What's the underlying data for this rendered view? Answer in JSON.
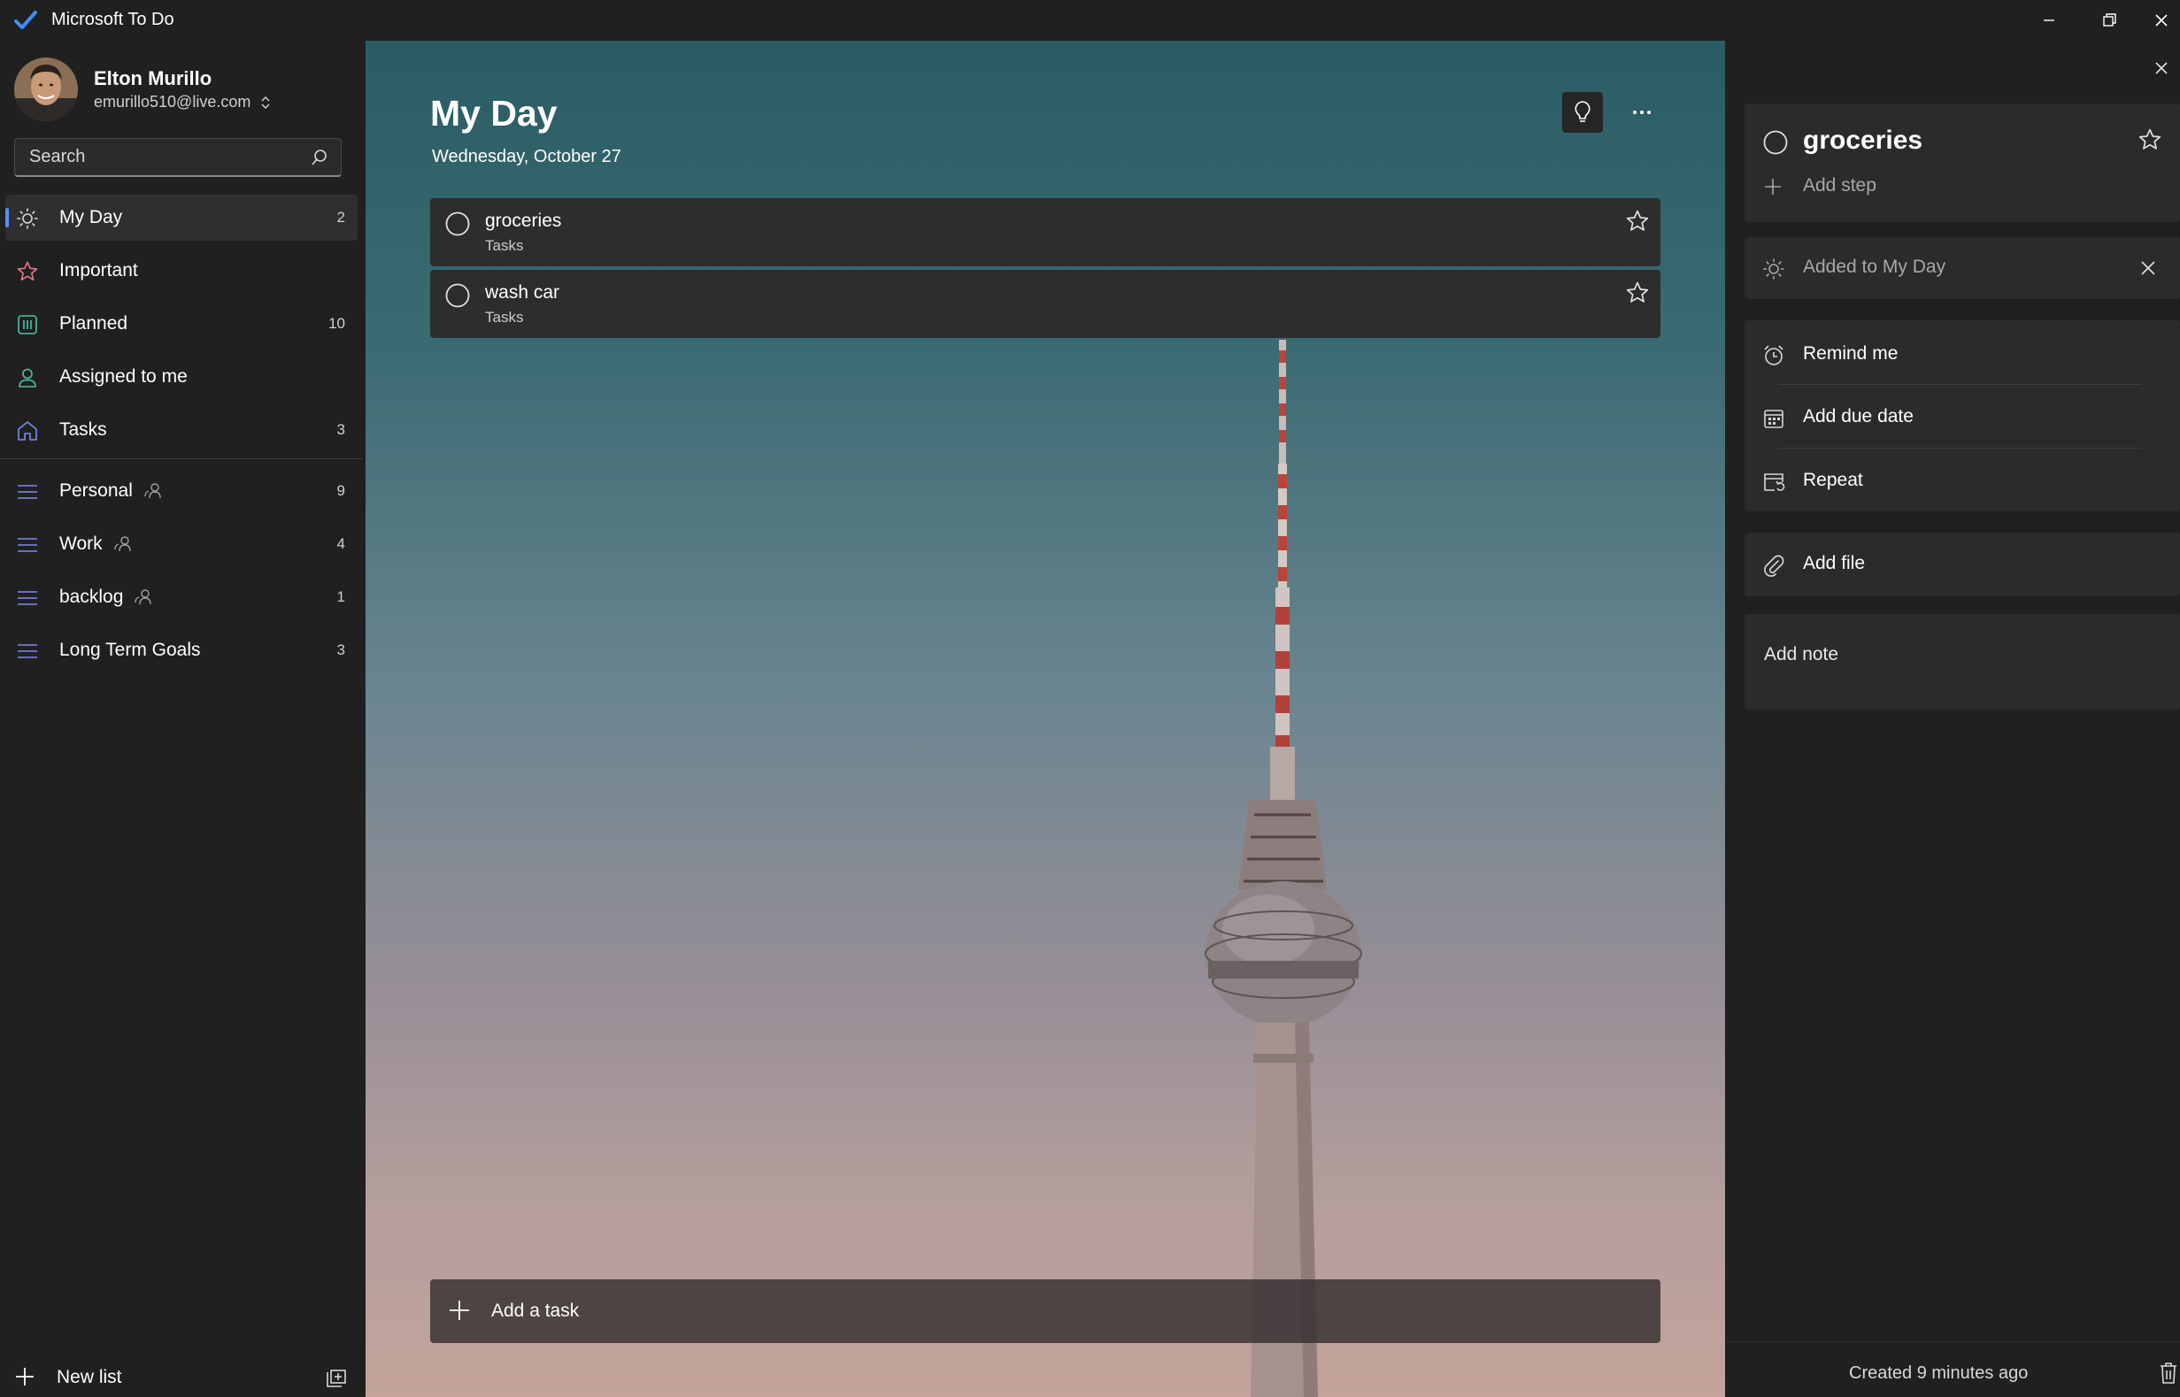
{
  "window": {
    "title": "Microsoft To Do",
    "icon": "checkmark-app-icon",
    "controls": [
      "minimize-icon",
      "restore-icon",
      "close-icon"
    ]
  },
  "user": {
    "name": "Elton Murillo",
    "email": "emurillo510@live.com"
  },
  "search": {
    "placeholder": "Search",
    "value": ""
  },
  "nav": {
    "smart_lists": [
      {
        "label": "My Day",
        "count": "2",
        "icon": "sun-icon",
        "active": true
      },
      {
        "label": "Important",
        "count": "",
        "icon": "star-icon"
      },
      {
        "label": "Planned",
        "count": "10",
        "icon": "calendar-grid-icon"
      },
      {
        "label": "Assigned to me",
        "count": "",
        "icon": "person-icon"
      },
      {
        "label": "Tasks",
        "count": "3",
        "icon": "home-icon"
      }
    ],
    "custom_lists": [
      {
        "label": "Personal",
        "count": "9",
        "shared": true,
        "icon": "list-lines-icon"
      },
      {
        "label": "Work",
        "count": "4",
        "shared": true,
        "icon": "list-lines-icon"
      },
      {
        "label": "backlog",
        "count": "1",
        "shared": true,
        "icon": "list-lines-icon"
      },
      {
        "label": "Long Term Goals",
        "count": "3",
        "shared": false,
        "icon": "list-lines-icon"
      }
    ],
    "new_list_label": "New list"
  },
  "main": {
    "title": "My Day",
    "date": "Wednesday, October 27",
    "tasks": [
      {
        "title": "groceries",
        "list": "Tasks"
      },
      {
        "title": "wash car",
        "list": "Tasks"
      }
    ],
    "add_task_label": "Add a task"
  },
  "detail": {
    "task_title": "groceries",
    "add_step_label": "Add step",
    "my_day_label": "Added to My Day",
    "remind_label": "Remind me",
    "due_label": "Add due date",
    "repeat_label": "Repeat",
    "file_label": "Add file",
    "note_label": "Add note",
    "footer": "Created 9 minutes ago"
  },
  "colors": {
    "accent": "#5b8ef5",
    "background": "#202020",
    "card": "#2b2b2b"
  }
}
